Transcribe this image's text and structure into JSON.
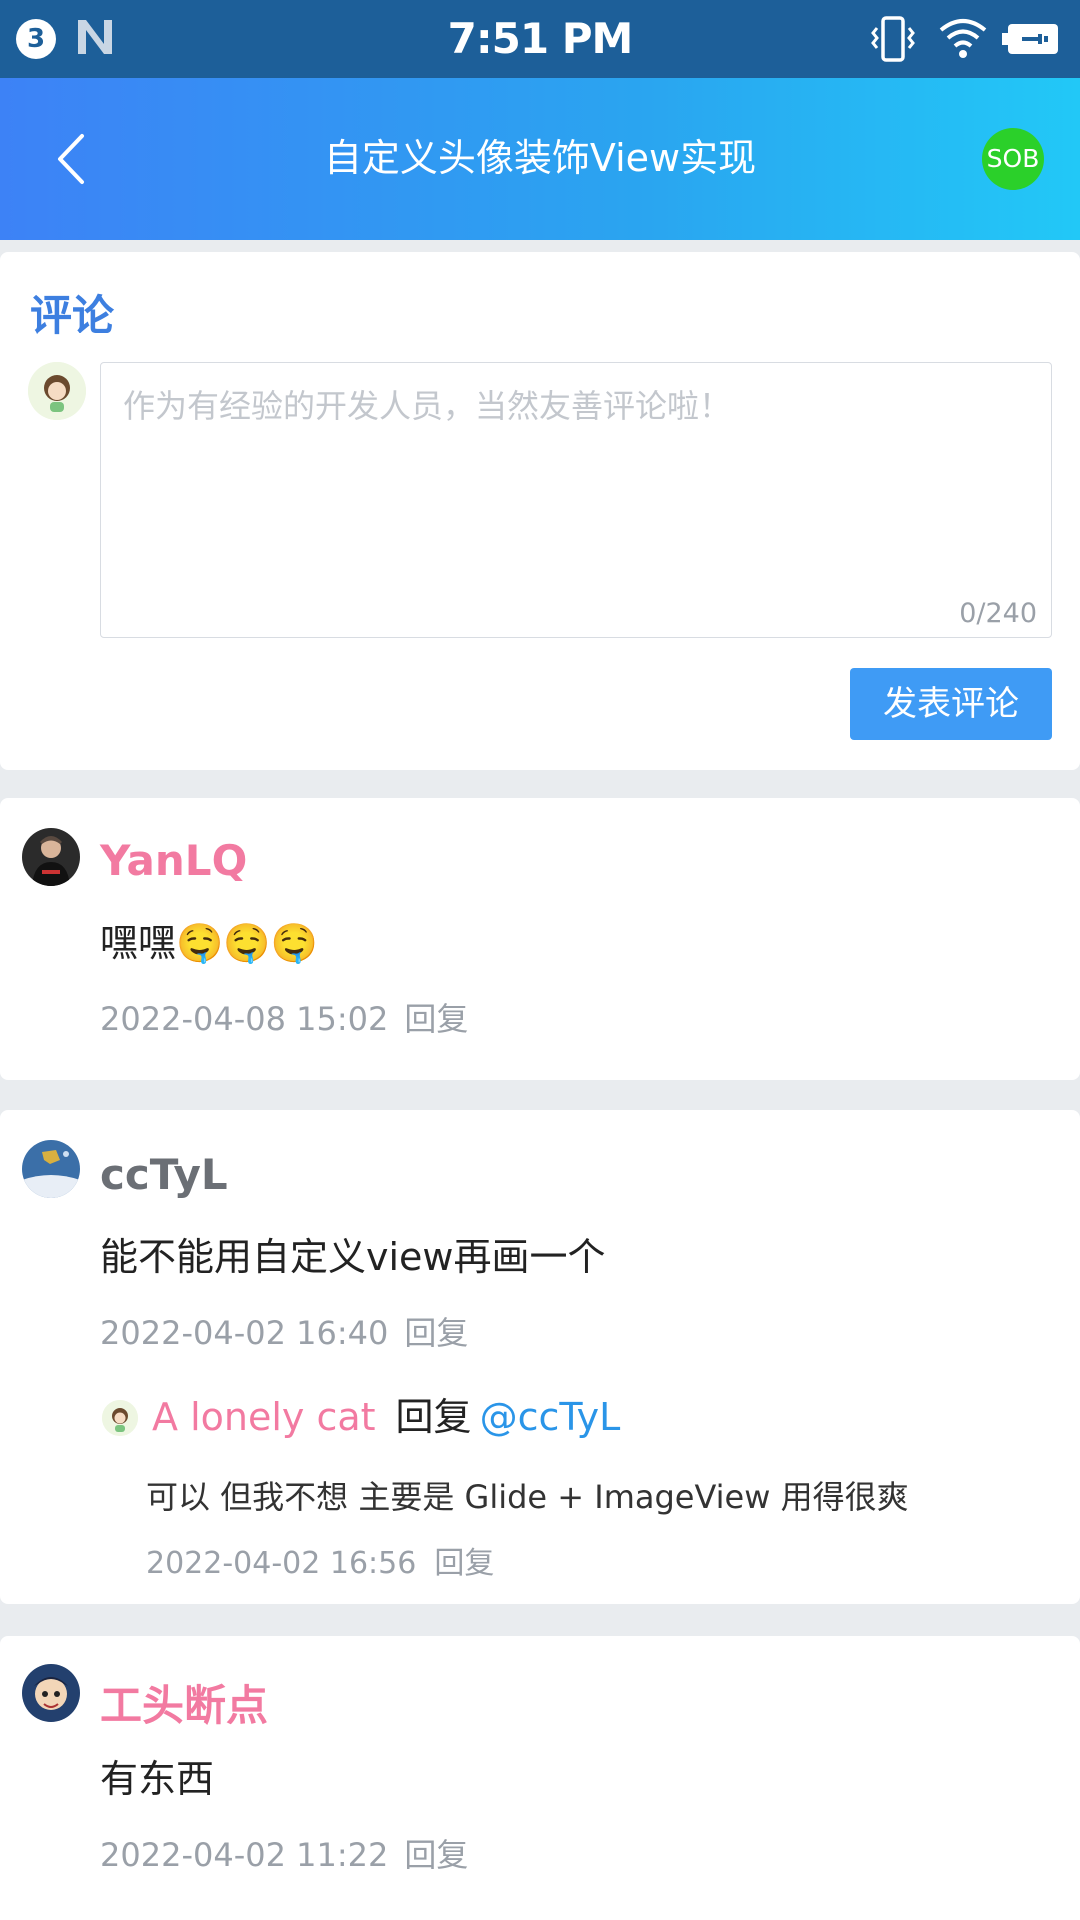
{
  "status_bar": {
    "badge": "3",
    "time": "7:51 PM"
  },
  "toolbar": {
    "title": "自定义头像装饰View实现",
    "logo_text": "SOB"
  },
  "comment_form": {
    "section_title": "评论",
    "placeholder": "作为有经验的开发人员，当然友善评论啦！",
    "value": "",
    "char_count": "0/240",
    "submit_label": "发表评论"
  },
  "comments": [
    {
      "author": "YanLQ",
      "content": "嘿嘿🤤🤤🤤",
      "time": "2022-04-08 15:02",
      "reply_label": "回复"
    },
    {
      "author": "ccTyL",
      "content": "能不能用自定义view再画一个",
      "time": "2022-04-02 16:40",
      "reply_label": "回复",
      "replies": [
        {
          "author": "A lonely cat",
          "reply_word": "回复",
          "target": "@ccTyL",
          "content": "可以 但我不想 主要是 Glide + ImageView 用得很爽",
          "time": "2022-04-02 16:56",
          "reply_label": "回复"
        }
      ]
    },
    {
      "author": "工头断点",
      "content": "有东西",
      "time": "2022-04-02 11:22",
      "reply_label": "回复"
    }
  ],
  "colors": {
    "accent": "#3f9bf5",
    "username_pink": "#f27aa1",
    "username_gray": "#6b6f75",
    "link_blue": "#2a95e8",
    "status_bar": "#1d5f99",
    "logo_green": "#2bd02a"
  }
}
